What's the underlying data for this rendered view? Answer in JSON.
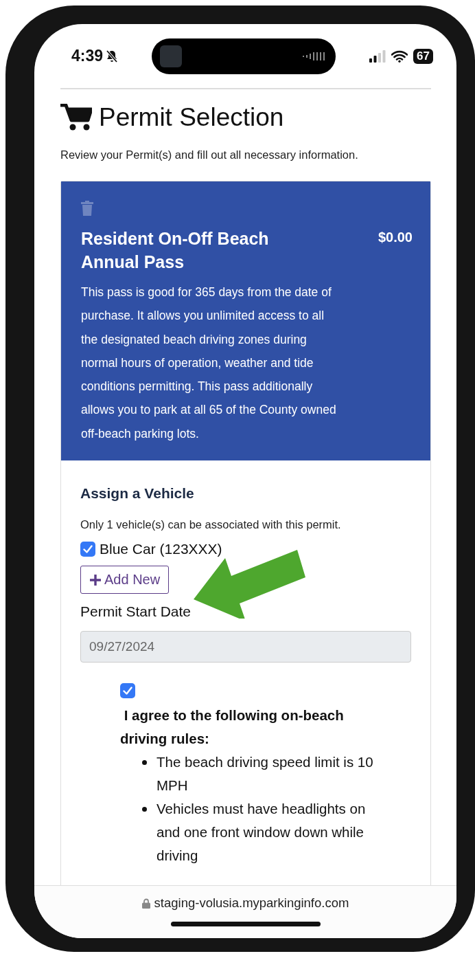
{
  "status_bar": {
    "time": "4:39",
    "silent": true,
    "battery": "67"
  },
  "page": {
    "title": "Permit Selection",
    "subtitle": "Review your Permit(s) and fill out all necessary information."
  },
  "permit": {
    "name": "Resident On-Off Beach Annual Pass",
    "price": "$0.00",
    "description": "This pass is good for 365 days from the date of purchase. It allows you unlimited access to all the designated beach driving zones during normal hours of operation, weather and tide conditions permitting. This pass additionally allows you to park at all 65 of the County owned off-beach parking lots."
  },
  "vehicle_section": {
    "heading": "Assign a Vehicle",
    "note": "Only 1 vehicle(s) can be associated with this permit.",
    "vehicles": [
      {
        "label": "Blue Car (123XXX)",
        "checked": true
      }
    ],
    "add_button": "Add New"
  },
  "start_date": {
    "label": "Permit Start Date",
    "value": "09/27/2024",
    "disabled": true
  },
  "agreement": {
    "checked": true,
    "heading": "I agree to the following on-beach driving rules:",
    "rules": [
      "The beach driving speed limit is 10 MPH",
      "Vehicles must have headlights on and one front window down while driving"
    ]
  },
  "browser": {
    "url": "staging-volusia.myparkinginfo.com"
  }
}
